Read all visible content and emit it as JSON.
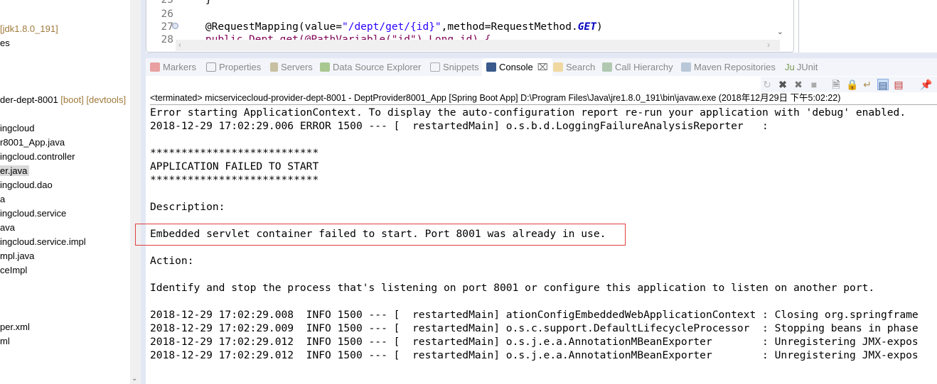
{
  "explorer": {
    "items": [
      {
        "text": "",
        "dec": "[jdk1.8.0_191]"
      },
      {
        "text": "es",
        "dec": ""
      },
      {
        "text": "der-dept-8001 ",
        "dec": "[boot] [devtools]"
      },
      {
        "text": "ingcloud",
        "dec": ""
      },
      {
        "text": "r8001_App.java",
        "dec": ""
      },
      {
        "text": "ingcloud.controller",
        "dec": ""
      },
      {
        "text": "er.java",
        "dec": "",
        "selected": true
      },
      {
        "text": "ingcloud.dao",
        "dec": ""
      },
      {
        "text": "a",
        "dec": ""
      },
      {
        "text": "ingcloud.service",
        "dec": ""
      },
      {
        "text": "ava",
        "dec": ""
      },
      {
        "text": "ingcloud.service.impl",
        "dec": ""
      },
      {
        "text": "mpl.java",
        "dec": ""
      },
      {
        "text": "ceImpl",
        "dec": ""
      },
      {
        "text": "per.xml",
        "dec": ""
      },
      {
        "text": "ml",
        "dec": ""
      }
    ]
  },
  "editor": {
    "lines": [
      {
        "num": "25",
        "code": "    }"
      },
      {
        "num": "26",
        "code": ""
      },
      {
        "num": "27",
        "code_pre": "    @RequestMapping(value=",
        "code_str": "\"/dept/get/{id}\"",
        "code_mid": ",method=RequestMethod.",
        "code_kw": "GET",
        "code_post": ")"
      },
      {
        "num": "28",
        "code": "    public Dept get(@PathVariable(\"id\") Long id) {"
      }
    ]
  },
  "tabs": [
    {
      "label": "Markers",
      "icon": "markers-icon"
    },
    {
      "label": "Properties",
      "icon": "properties-icon"
    },
    {
      "label": "Servers",
      "icon": "servers-icon"
    },
    {
      "label": "Data Source Explorer",
      "icon": "data-source-icon"
    },
    {
      "label": "Snippets",
      "icon": "snippets-icon"
    },
    {
      "label": "Console",
      "icon": "console-icon",
      "active": true
    },
    {
      "label": "Search",
      "icon": "search-icon"
    },
    {
      "label": "Call Hierarchy",
      "icon": "call-hierarchy-icon"
    },
    {
      "label": "Maven Repositories",
      "icon": "maven-icon"
    },
    {
      "label": "JUnit",
      "icon": "junit-icon"
    }
  ],
  "console": {
    "status": "<terminated> micservicecloud-provider-dept-8001 - DeptProvider8001_App [Spring Boot App] D:\\Program Files\\Java\\jre1.8.0_191\\bin\\javaw.exe (2018年12月29日 下午5:02:22)",
    "lines": [
      "Error starting ApplicationContext. To display the auto-configuration report re-run your application with 'debug' enabled.",
      "2018-12-29 17:02:29.006 ERROR 1500 --- [  restartedMain] o.s.b.d.LoggingFailureAnalysisReporter   :",
      "",
      "***************************",
      "APPLICATION FAILED TO START",
      "***************************",
      "",
      "Description:",
      "",
      "Embedded servlet container failed to start. Port 8001 was already in use.",
      "",
      "Action:",
      "",
      "Identify and stop the process that's listening on port 8001 or configure this application to listen on another port.",
      "",
      "2018-12-29 17:02:29.008  INFO 1500 --- [  restartedMain] ationConfigEmbeddedWebApplicationContext : Closing org.springframe",
      "2018-12-29 17:02:29.009  INFO 1500 --- [  restartedMain] o.s.c.support.DefaultLifecycleProcessor  : Stopping beans in phase",
      "2018-12-29 17:02:29.012  INFO 1500 --- [  restartedMain] o.s.j.e.a.AnnotationMBeanExporter        : Unregistering JMX-expos",
      "2018-12-29 17:02:29.012  INFO 1500 --- [  restartedMain] o.s.j.e.a.AnnotationMBeanExporter        : Unregistering JMX-expos"
    ]
  }
}
